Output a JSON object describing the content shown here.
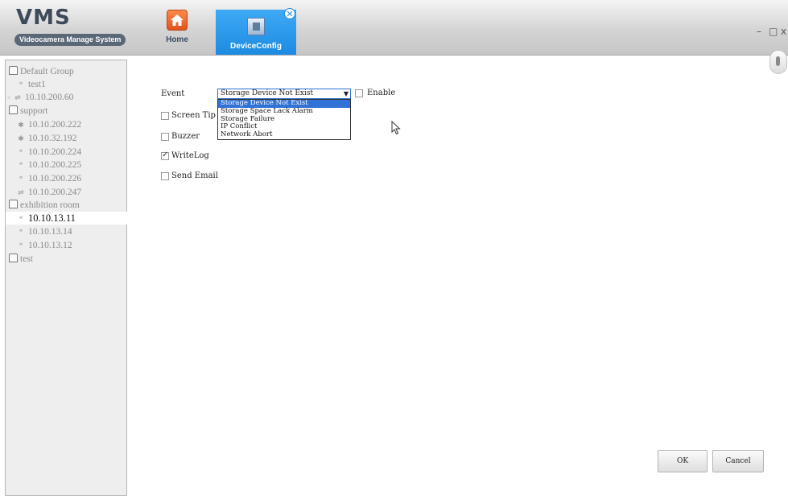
{
  "app": {
    "title": "VMS",
    "subtitle": "Videocamera Manage System"
  },
  "tabs": [
    {
      "label": "Home",
      "icon": "home-icon",
      "active": false
    },
    {
      "label": "DeviceConfig",
      "icon": "device-config-icon",
      "active": true
    }
  ],
  "window_controls": {
    "minimize": "–",
    "maximize": "□",
    "close": "x"
  },
  "tree": [
    {
      "label": "Default Group",
      "kind": "group"
    },
    {
      "label": "test1",
      "kind": "device"
    },
    {
      "label": "10.10.200.60",
      "kind": "device"
    },
    {
      "label": "support",
      "kind": "group"
    },
    {
      "label": "10.10.200.222",
      "kind": "device"
    },
    {
      "label": "10.10.32.192",
      "kind": "device"
    },
    {
      "label": "10.10.200.224",
      "kind": "device"
    },
    {
      "label": "10.10.200.225",
      "kind": "device"
    },
    {
      "label": "10.10.200.226",
      "kind": "device"
    },
    {
      "label": "10.10.200.247",
      "kind": "device"
    },
    {
      "label": "exhibition room",
      "kind": "group"
    },
    {
      "label": "10.10.13.11",
      "kind": "device",
      "selected": true
    },
    {
      "label": "10.10.13.14",
      "kind": "device"
    },
    {
      "label": "10.10.13.12",
      "kind": "device"
    },
    {
      "label": "test",
      "kind": "group"
    }
  ],
  "config": {
    "event_label": "Event",
    "event_selected": "Storage Device Not Exist",
    "event_options": [
      "Storage Device Not Exist",
      "Storage Space Lack Alarm",
      "Storage Failure",
      "IP Conflict",
      "Network Abort"
    ],
    "enable_label": "Enable",
    "enable_checked": false,
    "screen_tip_label": "Screen Tip",
    "screen_tip_checked": false,
    "buzzer_label": "Buzzer",
    "buzzer_checked": false,
    "writelog_label": "WriteLog",
    "writelog_checked": true,
    "send_email_label": "Send Email",
    "send_email_checked": false
  },
  "buttons": {
    "ok": "OK",
    "cancel": "Cancel"
  },
  "colors": {
    "active_tab": "#1c8be0",
    "selected_option": "#3172d6",
    "home_icon": "#e0531c"
  }
}
